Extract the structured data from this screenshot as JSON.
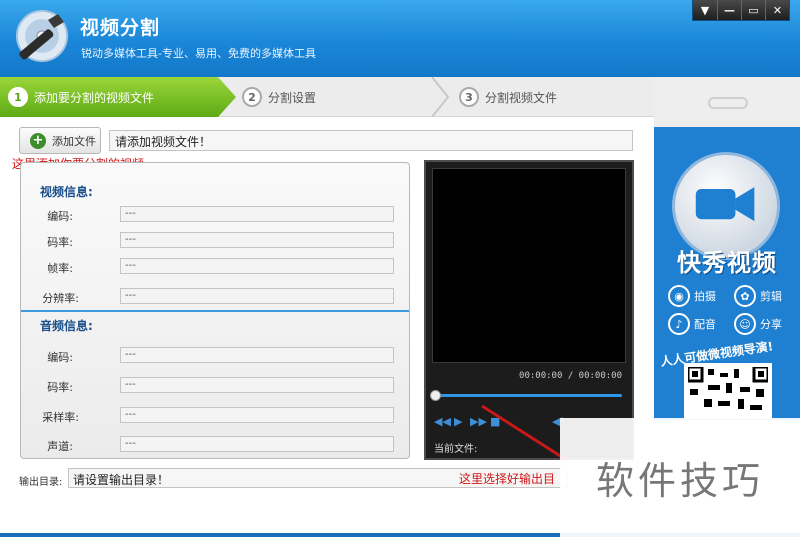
{
  "app": {
    "title": "视频分割",
    "subtitle": "锐动多媒体工具-专业、易用、免费的多媒体工具"
  },
  "window_controls": [
    "▼",
    "—",
    "▭",
    "✕"
  ],
  "steps": [
    {
      "num": "1",
      "label": "添加要分割的视频文件",
      "active": true
    },
    {
      "num": "2",
      "label": "分割设置",
      "active": false
    },
    {
      "num": "3",
      "label": "分割视频文件",
      "active": false
    }
  ],
  "add_file": {
    "button_label": "添加文件",
    "placeholder": "请添加视频文件！",
    "hint": "这里添加你要分割的视频"
  },
  "video_info": {
    "title": "视频信息:",
    "rows": [
      {
        "label": "编码:",
        "value": "---"
      },
      {
        "label": "码率:",
        "value": "---"
      },
      {
        "label": "帧率:",
        "value": "---"
      },
      {
        "label": "分辨率:",
        "value": "---"
      }
    ]
  },
  "audio_info": {
    "title": "音频信息:",
    "rows": [
      {
        "label": "编码:",
        "value": "---"
      },
      {
        "label": "码率:",
        "value": "---"
      },
      {
        "label": "采样率:",
        "value": "---"
      },
      {
        "label": "声道:",
        "value": "---"
      }
    ]
  },
  "player": {
    "time": "00:00:00 / 00:00:00",
    "current_file_label": "当前文件:",
    "progress": 0
  },
  "output": {
    "label": "输出目录:",
    "placeholder": "请设置输出目录！",
    "hint": "这里选择好输出目"
  },
  "ad": {
    "brand": "快秀视频",
    "features": [
      "拍摄",
      "剪辑",
      "配音",
      "分享"
    ],
    "slogan": "人人可做微视频导演!"
  },
  "watermark": "软件技巧",
  "colors": {
    "header": "#1a86d8",
    "step_active": "#6fb51f",
    "hint": "#d01818",
    "section_title": "#1a4f8a"
  }
}
